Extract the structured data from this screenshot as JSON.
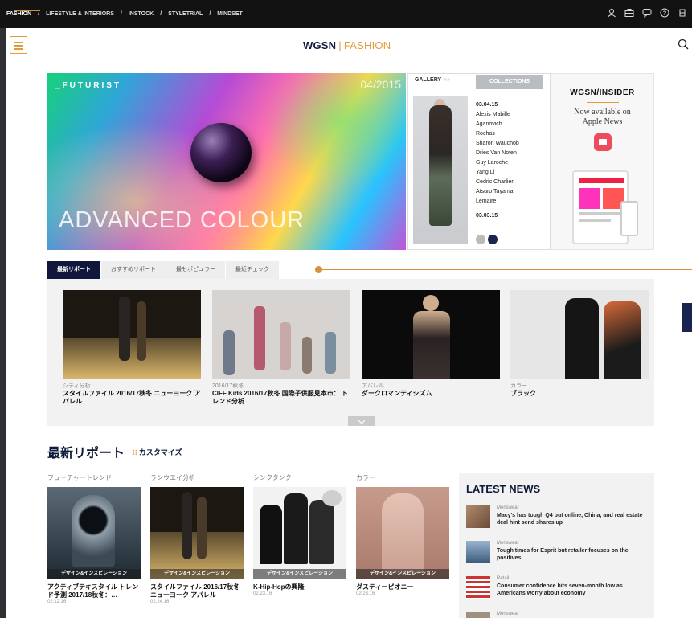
{
  "topnav": {
    "items": [
      "FASHION",
      "LIFESTYLE & INTERIORS",
      "INSTOCK",
      "STYLETRIAL",
      "MINDSET"
    ],
    "separator": "/",
    "icons": [
      "user-icon",
      "briefcase-icon",
      "chat-icon",
      "help-icon",
      "more-icon"
    ]
  },
  "header": {
    "logo_main": "WGSN",
    "logo_sep": "|",
    "logo_sub": "FASHION",
    "menu_icon": "hamburger-icon",
    "search_icon": "search-icon"
  },
  "hero": {
    "kicker": "_FUTURIST",
    "date": "04/2015",
    "headline": "ADVANCED COLOUR"
  },
  "gallery": {
    "tab_gallery": "GALLERY",
    "tab_arrows": "»»",
    "tab_collections": "COLLECTIONS",
    "entries": [
      "03.04.15",
      "Alexis Mabille",
      "Aganovich",
      "Rochas",
      "Sharon Wauchob",
      "Dries Van Noten",
      "Guy Laroche",
      "Yang Li",
      "Cedric Charlier",
      "Atsuro Tayama",
      "Lemaire",
      "",
      "03.03.15"
    ]
  },
  "insider": {
    "title": "WGSN/INSIDER",
    "line1": "Now available on",
    "line2": "Apple News"
  },
  "tabs": [
    "最新リポート",
    "おすすめリポート",
    "最もポピュラー",
    "最近チェック"
  ],
  "featured": [
    {
      "category": "シティ分析",
      "title": "スタイルファイル 2016/17秋冬 ニューヨーク アパレル"
    },
    {
      "category": "2016/17秋冬",
      "title": "CIFF Kids 2016/17秋冬 国際子供服見本市： トレンド分析"
    },
    {
      "category": "アパレル",
      "title": "ダークロマンティシズム"
    },
    {
      "category": "カラー",
      "title": "ブラック"
    }
  ],
  "latest": {
    "title": "最新リポート",
    "customize": "カスタマイズ",
    "customize_icon": "⁝⁝",
    "items": [
      {
        "category": "フューチャートレンド",
        "label": "デザイン&インスピレーション",
        "title": "アクティブテキスタイル トレンド予測 2017/18秋冬：…",
        "date": "02.12.16"
      },
      {
        "category": "ランウエイ分析",
        "label": "デザイン&インスピレーション",
        "title": "スタイルファイル 2016/17秋冬 ニューヨーク アパレル",
        "date": "02.24.16"
      },
      {
        "category": "シンクタンク",
        "label": "デザイン&インスピレーション",
        "title": "K-Hip-Hopの興隆",
        "date": "02.23.16"
      },
      {
        "category": "カラー",
        "label": "デザイン&インスピレーション",
        "title": "ダスティーピオニー",
        "date": "02.23.16"
      }
    ]
  },
  "news": {
    "title": "LATEST NEWS",
    "items": [
      {
        "category": "Menswear",
        "title": "Macy's has tough Q4 but online, China, and real estate deal hint send shares up"
      },
      {
        "category": "Menswear",
        "title": "Tough times for Esprit but retailer focuses on the positives"
      },
      {
        "category": "Retail",
        "title": "Consumer confidence hits seven-month low as Americans worry about economy"
      },
      {
        "category": "Menswear",
        "title": ""
      }
    ]
  },
  "colors": {
    "accent": "#e39a3a",
    "navy": "#0f1a3a"
  }
}
